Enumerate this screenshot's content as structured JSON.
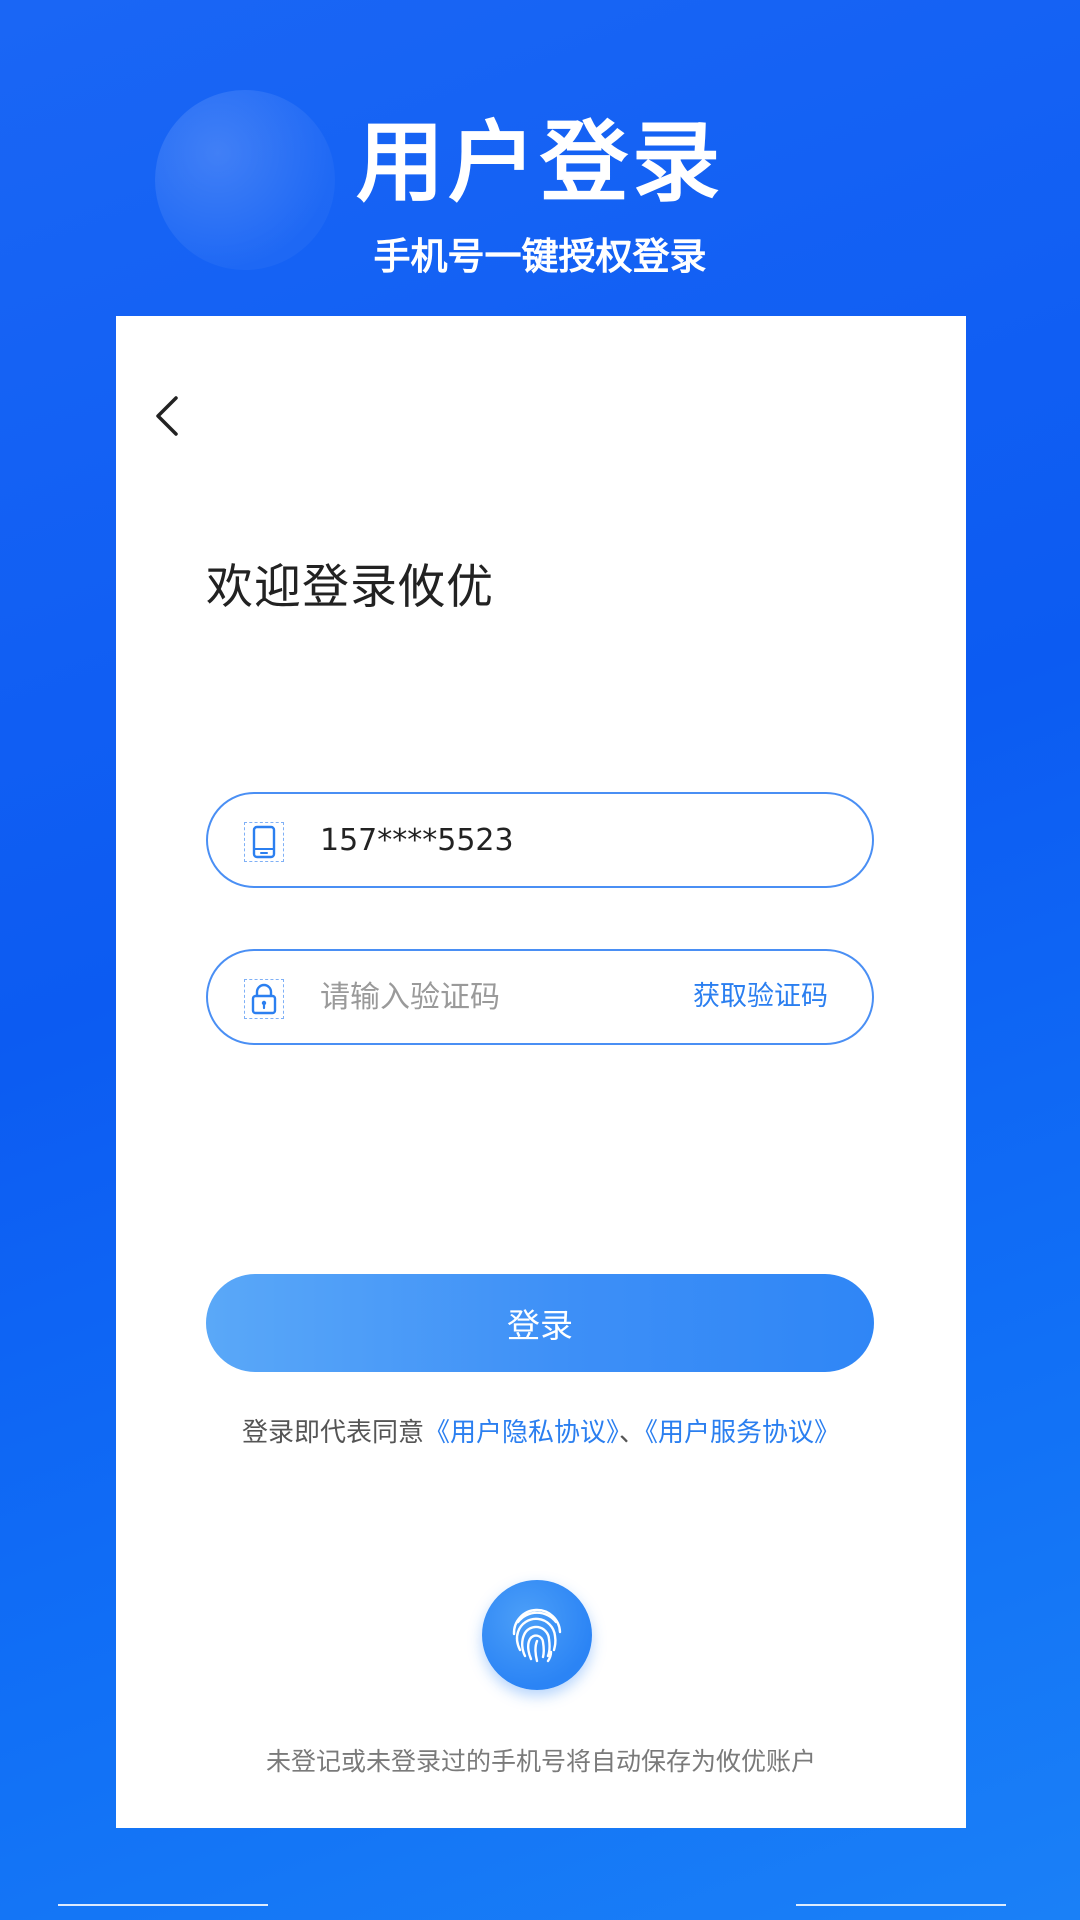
{
  "header": {
    "title": "用户登录",
    "subtitle": "手机号一键授权登录"
  },
  "card": {
    "back_icon": "chevron-left-icon",
    "welcome": "欢迎登录攸优",
    "phone_field": {
      "icon": "phone-icon",
      "value": "157****5523"
    },
    "code_field": {
      "icon": "lock-icon",
      "placeholder": "请输入验证码",
      "get_code_label": "获取验证码"
    },
    "login_button": "登录",
    "agreement": {
      "prefix": "登录即代表同意",
      "privacy_link": "《用户隐私协议》",
      "separator": "、",
      "service_link": "《用户服务协议》"
    },
    "fingerprint_icon": "fingerprint-icon",
    "footnote": "未登记或未登录过的手机号将自动保存为攸优账户"
  },
  "colors": {
    "background": "#0c5bf2",
    "accent": "#2b7ff0",
    "button": "#3d8ff7",
    "field_border": "#4a8ff4"
  }
}
